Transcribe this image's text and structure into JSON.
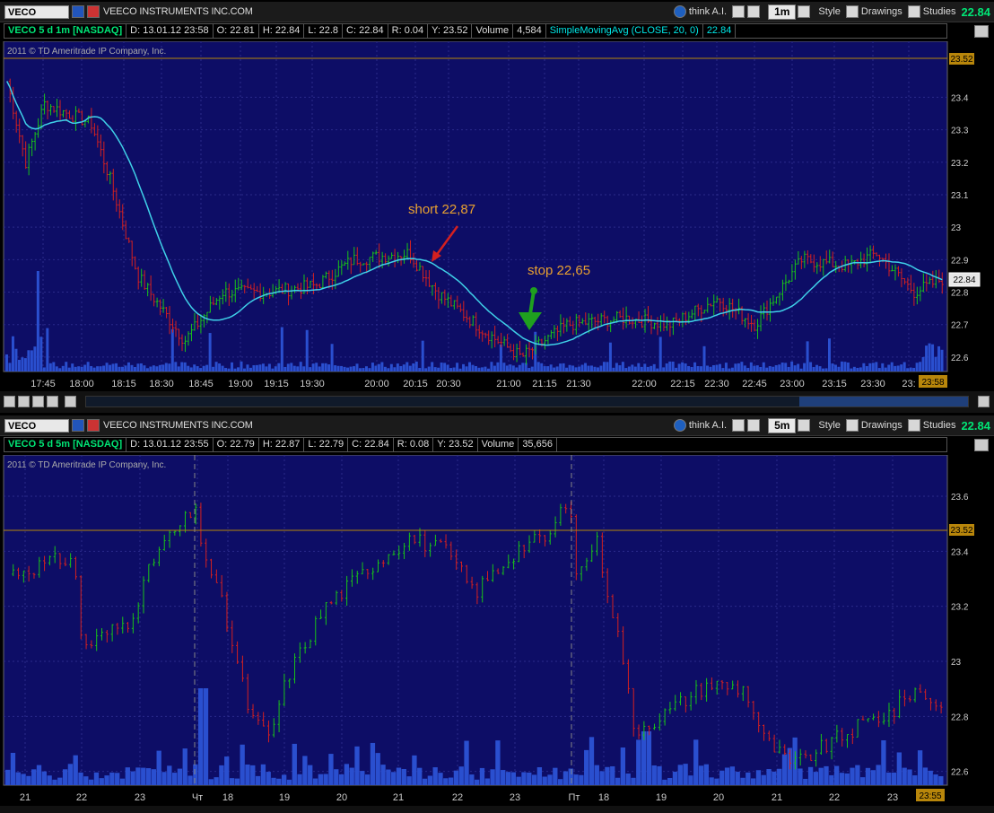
{
  "top": {
    "symbol": "VECO",
    "company": "VEECO INSTRUMENTS INC.COM",
    "thinkai": "think A.I.",
    "timeframe": "1m",
    "style": "Style",
    "drawings": "Drawings",
    "studies": "Studies",
    "last": "22.84",
    "info": {
      "title": "VECO 5 d 1m [NASDAQ]",
      "d": "D: 13.01.12 23:58",
      "o": "O: 22.81",
      "h": "H: 22.84",
      "l": "L: 22.8",
      "c": "C: 22.84",
      "r": "R: 0.04",
      "y": "Y: 23.52",
      "vol_label": "Volume",
      "vol": "4,584",
      "study": "SimpleMovingAvg (CLOSE, 20, 0)",
      "study_val": "22.84"
    },
    "copyright": "2011 © TD Ameritrade IP Company, Inc.",
    "yticks": [
      "23.4",
      "23.3",
      "23.2",
      "23.1",
      "23",
      "22.9",
      "22.8",
      "22.7",
      "22.6"
    ],
    "xticks": [
      "17:45",
      "18:00",
      "18:15",
      "18:30",
      "18:45",
      "19:00",
      "19:15",
      "19:30",
      "20:00",
      "20:15",
      "20:30",
      "21:00",
      "21:15",
      "21:30",
      "22:00",
      "22:15",
      "22:30",
      "22:45",
      "23:00",
      "23:15",
      "23:30",
      "23:"
    ],
    "ref_label": "23.52",
    "price_label": "22.84",
    "time_label": "23:58",
    "annot_short": "short 22,87",
    "annot_stop": "stop 22,65",
    "colors": {
      "up": "#19c219",
      "down": "#d42020",
      "sma": "#3fd0e8",
      "volume": "#2a4fcf",
      "bg": "#0d0d66"
    }
  },
  "bottom": {
    "symbol": "VECO",
    "company": "VEECO INSTRUMENTS INC.COM",
    "thinkai": "think A.I.",
    "timeframe": "5m",
    "style": "Style",
    "drawings": "Drawings",
    "studies": "Studies",
    "last": "22.84",
    "info": {
      "title": "VECO 5 d 5m [NASDAQ]",
      "d": "D: 13.01.12 23:55",
      "o": "O: 22.79",
      "h": "H: 22.87",
      "l": "L: 22.79",
      "c": "C: 22.84",
      "r": "R: 0.08",
      "y": "Y: 23.52",
      "vol_label": "Volume",
      "vol": "35,656"
    },
    "copyright": "2011 © TD Ameritrade IP Company, Inc.",
    "yticks": [
      "23.6",
      "23.4",
      "23.2",
      "23",
      "22.8",
      "22.6"
    ],
    "xticks": [
      "21",
      "22",
      "23",
      "Чт",
      "18",
      "19",
      "20",
      "21",
      "22",
      "23",
      "Пт",
      "18",
      "19",
      "20",
      "21",
      "22",
      "23"
    ],
    "ref_label": "23.52",
    "time_label": "23:55"
  }
}
